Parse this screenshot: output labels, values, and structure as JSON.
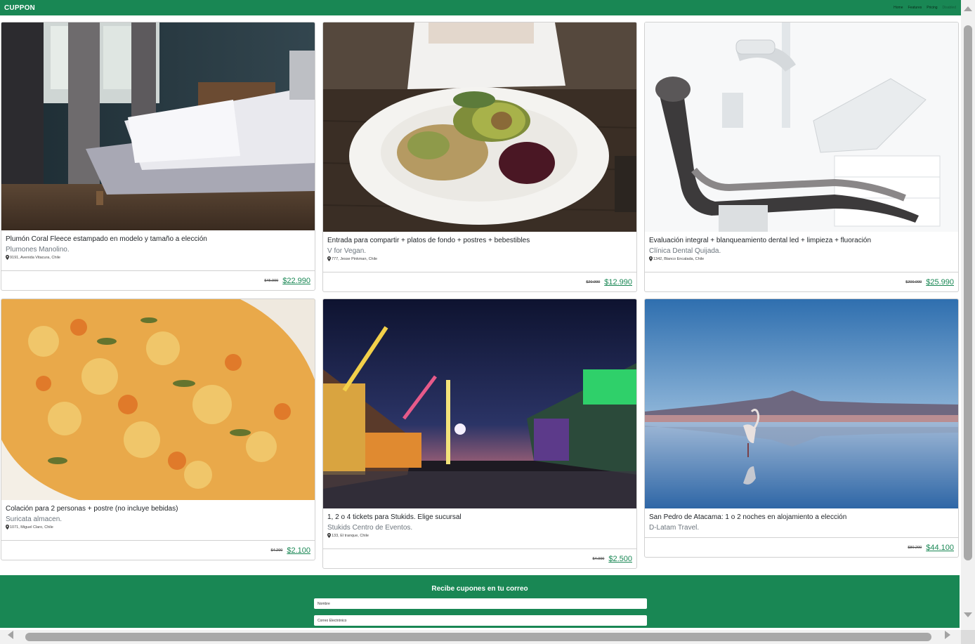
{
  "navbar": {
    "brand": "CUPPON",
    "links": [
      {
        "label": "Home"
      },
      {
        "label": "Features"
      },
      {
        "label": "Pricing"
      },
      {
        "label": "Disabled"
      }
    ]
  },
  "cards": [
    {
      "image": "bedroom-photo",
      "title": "Plumón Coral Fleece estampado en modelo y tamaño a elección",
      "company": "Plumones Manolino.",
      "address": "9191, Avenida Vitacura, Chile",
      "old_price": "$45.990",
      "price": "$22.990"
    },
    {
      "image": "salad-photo",
      "title": "Entrada para compartir + platos de fondo + postres + bebestibles",
      "company": "V for Vegan.",
      "address": "777, Jesse Pinkman, Chile",
      "old_price": "$20.990",
      "price": "$12.990"
    },
    {
      "image": "dental-chair-photo",
      "title": "Evaluación integral + blanqueamiento dental led + limpieza + fluoración",
      "company": "Clínica Dental Quijada.",
      "address": "1342, Blanco Encalada, Chile",
      "old_price": "$200.000",
      "price": "$25.990"
    },
    {
      "image": "food-dish-photo",
      "title": "Colación para 2 personas + postre (no incluye bebidas)",
      "company": "Suricata almacen.",
      "address": "1071, Miguel Claro, Chile",
      "old_price": "$4.200",
      "price": "$2.100"
    },
    {
      "image": "fair-night-photo",
      "title": "1, 2 o 4 tickets para Stukids. Elige sucursal",
      "company": "Stukids Centro de Eventos.",
      "address": "133, El tranque, Chile",
      "old_price": "$4.000",
      "price": "$2.500"
    },
    {
      "image": "flamingo-lake-photo",
      "title": "San Pedro de Atacama: 1 o 2 noches en alojamiento a elección",
      "company": "D-Latam Travel.",
      "address": "",
      "old_price": "$80.200",
      "price": "$44.100"
    }
  ],
  "newsletter": {
    "title": "Recibe cupones en tu correo",
    "name_placeholder": "Nombre",
    "email_placeholder": "Correo Electrónico"
  }
}
